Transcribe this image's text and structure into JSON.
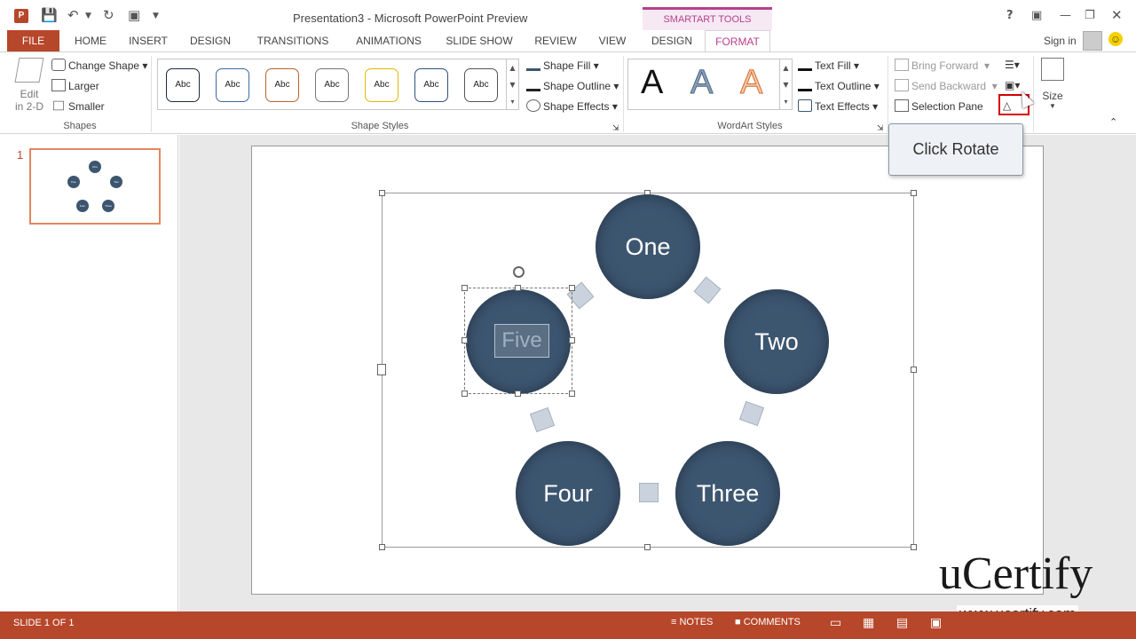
{
  "window": {
    "title": "Presentation3 - Microsoft PowerPoint Preview",
    "contextual_group": "SMARTART TOOLS"
  },
  "tabs": [
    {
      "label": "FILE"
    },
    {
      "label": "HOME"
    },
    {
      "label": "INSERT"
    },
    {
      "label": "DESIGN"
    },
    {
      "label": "TRANSITIONS"
    },
    {
      "label": "ANIMATIONS"
    },
    {
      "label": "SLIDE SHOW"
    },
    {
      "label": "REVIEW"
    },
    {
      "label": "VIEW"
    },
    {
      "label": "DESIGN"
    },
    {
      "label": "FORMAT"
    }
  ],
  "account": {
    "sign_in": "Sign in"
  },
  "ribbon": {
    "shapes": {
      "group_label": "Shapes",
      "edit_2d": "Edit",
      "edit_2d_line2": "in 2-D",
      "change_shape": "Change Shape",
      "larger": "Larger",
      "smaller": "Smaller"
    },
    "shape_styles": {
      "group_label": "Shape Styles",
      "swatch_label": "Abc",
      "swatch_colors": [
        "#1f2b3c",
        "#3f6aa0",
        "#c0602f",
        "#777777",
        "#e5b800",
        "#2f4f80",
        "#555555"
      ],
      "shape_fill": "Shape Fill",
      "shape_outline": "Shape Outline",
      "shape_effects": "Shape Effects"
    },
    "wordart_styles": {
      "group_label": "WordArt Styles",
      "letter": "A",
      "text_fill": "Text Fill",
      "text_outline": "Text Outline",
      "text_effects": "Text Effects"
    },
    "arrange": {
      "bring_forward": "Bring Forward",
      "send_backward": "Send Backward",
      "selection_pane": "Selection Pane"
    },
    "size": {
      "label": "Size"
    }
  },
  "thumbnails": {
    "slide_number": "1",
    "nodes": [
      "One",
      "Two",
      "Three",
      "Four",
      "Five"
    ]
  },
  "smartart": {
    "nodes": [
      "One",
      "Two",
      "Three",
      "Four",
      "Five"
    ],
    "node_color": "#3d5670"
  },
  "tooltip": {
    "text": "Click Rotate"
  },
  "watermark": {
    "logo": "uCertify",
    "url": "www.ucertify.com"
  },
  "status": {
    "slide_info": "SLIDE 1 OF 1",
    "notes": "NOTES",
    "comments": "COMMENTS"
  },
  "colors": {
    "accent": "#b7472a",
    "contextual": "#b73f8d"
  }
}
